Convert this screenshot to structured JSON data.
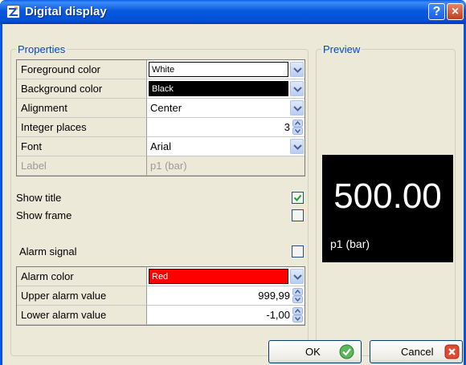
{
  "window": {
    "title": "Digital display",
    "help_glyph": "?",
    "close_glyph": "×"
  },
  "properties": {
    "legend": "Properties",
    "rows": [
      {
        "label": "Foreground color",
        "value": "White",
        "kind": "color",
        "swatch": "#ffffff",
        "text_color": "#000000"
      },
      {
        "label": "Background color",
        "value": "Black",
        "kind": "color",
        "swatch": "#000000",
        "text_color": "#ffffff"
      },
      {
        "label": "Alignment",
        "value": "Center",
        "kind": "combo"
      },
      {
        "label": "Integer places",
        "value": "3",
        "kind": "spin"
      },
      {
        "label": "Font",
        "value": "Arial",
        "kind": "combo"
      },
      {
        "label": "Label",
        "value": "p1 (bar)",
        "kind": "disabled"
      }
    ],
    "show_title": {
      "label": "Show title",
      "checked": true
    },
    "show_frame": {
      "label": "Show frame",
      "checked": false
    },
    "alarm_signal": {
      "label": "Alarm signal",
      "checked": false
    },
    "alarm_rows": [
      {
        "label": "Alarm color",
        "value": "Red",
        "kind": "color",
        "swatch": "#ff0000",
        "text_color": "#ffffff"
      },
      {
        "label": "Upper alarm value",
        "value": "999,99",
        "kind": "spin"
      },
      {
        "label": "Lower alarm value",
        "value": "-1,00",
        "kind": "spin"
      }
    ]
  },
  "preview": {
    "legend": "Preview",
    "value": "500.00",
    "label": "p1 (bar)"
  },
  "buttons": {
    "ok": "OK",
    "cancel": "Cancel"
  },
  "colors": {
    "title_bar": "#0055e5",
    "legend": "#0046d5",
    "dialog_bg": "#ece9d8",
    "check_green": "#21a121"
  }
}
